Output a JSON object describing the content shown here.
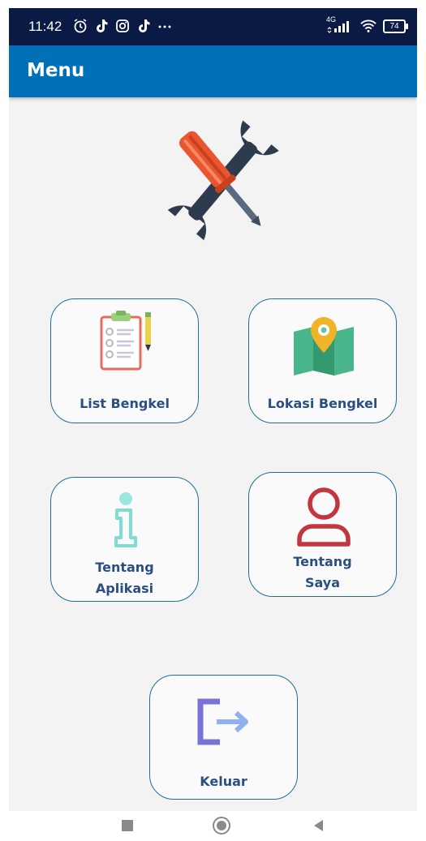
{
  "status_bar": {
    "time": "11:42",
    "left_icons": [
      "alarm-icon",
      "tiktok-icon",
      "instagram-icon",
      "tiktok-icon",
      "more-icon"
    ],
    "network": "4G",
    "battery": "74"
  },
  "app_bar": {
    "title": "Menu",
    "color": "#0070b8"
  },
  "menu": {
    "list_bengkel": "List Bengkel",
    "lokasi_bengkel": "Lokasi Bengkel",
    "tentang_aplikasi_line1": "Tentang",
    "tentang_aplikasi_line2": "Aplikasi",
    "tentang_saya_line1": "Tentang",
    "tentang_saya_line2": "Saya",
    "keluar": "Keluar"
  },
  "nav_bar": {
    "buttons": [
      "recent-apps",
      "home",
      "back"
    ]
  }
}
